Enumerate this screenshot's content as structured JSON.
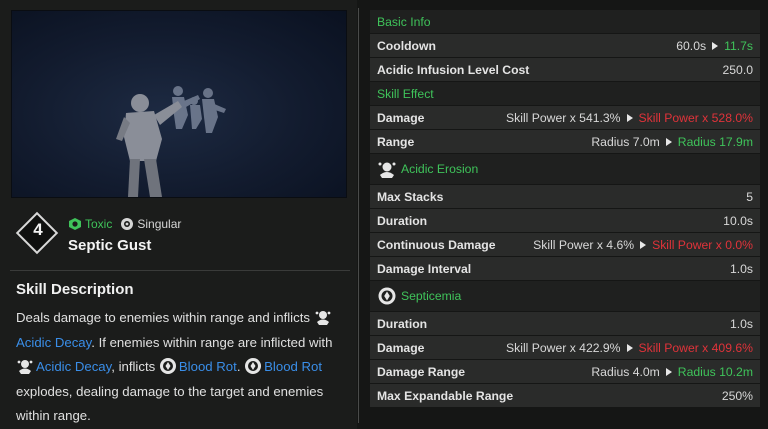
{
  "skill": {
    "level": "4",
    "tags": [
      {
        "label": "Toxic",
        "icon": "toxic-icon",
        "color": "#3fc35a"
      },
      {
        "label": "Singular",
        "icon": "singular-icon",
        "color": "#d6d6d6"
      }
    ],
    "name": "Septic Gust"
  },
  "description": {
    "title": "Skill Description",
    "text_1": "Deals damage to enemies within range and inflicts ",
    "kw_acidic_decay_1": "Acidic Decay",
    "text_2": ". If enemies within range are inflicted with ",
    "kw_acidic_decay_2": "Acidic Decay",
    "text_3": ", inflicts ",
    "kw_blood_rot_1": "Blood Rot",
    "text_4": ". ",
    "kw_blood_rot_2": "Blood Rot",
    "text_5": " explodes, dealing damage to the target and enemies within range."
  },
  "stats": {
    "basic_info": "Basic Info",
    "cooldown": {
      "label": "Cooldown",
      "from": "60.0s",
      "to": "11.7s"
    },
    "infusion_cost": {
      "label": "Acidic Infusion Level Cost",
      "value": "250.0"
    },
    "skill_effect": "Skill Effect",
    "damage": {
      "label": "Damage",
      "from": "Skill Power x 541.3%",
      "to": "Skill Power x 528.0%"
    },
    "range": {
      "label": "Range",
      "from": "Radius 7.0m",
      "to": "Radius 17.9m"
    },
    "acidic_erosion": "Acidic Erosion",
    "max_stacks": {
      "label": "Max Stacks",
      "value": "5"
    },
    "duration_1": {
      "label": "Duration",
      "value": "10.0s"
    },
    "continuous_damage": {
      "label": "Continuous Damage",
      "from": "Skill Power x 4.6%",
      "to": "Skill Power x 0.0%"
    },
    "damage_interval": {
      "label": "Damage Interval",
      "value": "1.0s"
    },
    "septicemia": "Septicemia",
    "duration_2": {
      "label": "Duration",
      "value": "1.0s"
    },
    "damage_2": {
      "label": "Damage",
      "from": "Skill Power x 422.9%",
      "to": "Skill Power x 409.6%"
    },
    "damage_range": {
      "label": "Damage Range",
      "from": "Radius 4.0m",
      "to": "Radius 10.2m"
    },
    "max_expandable_range": {
      "label": "Max Expandable Range",
      "value": "250%"
    }
  },
  "colors": {
    "accent_green": "#3fc35a",
    "decrease_red": "#e0333a",
    "keyword_blue": "#3a8ee8"
  }
}
